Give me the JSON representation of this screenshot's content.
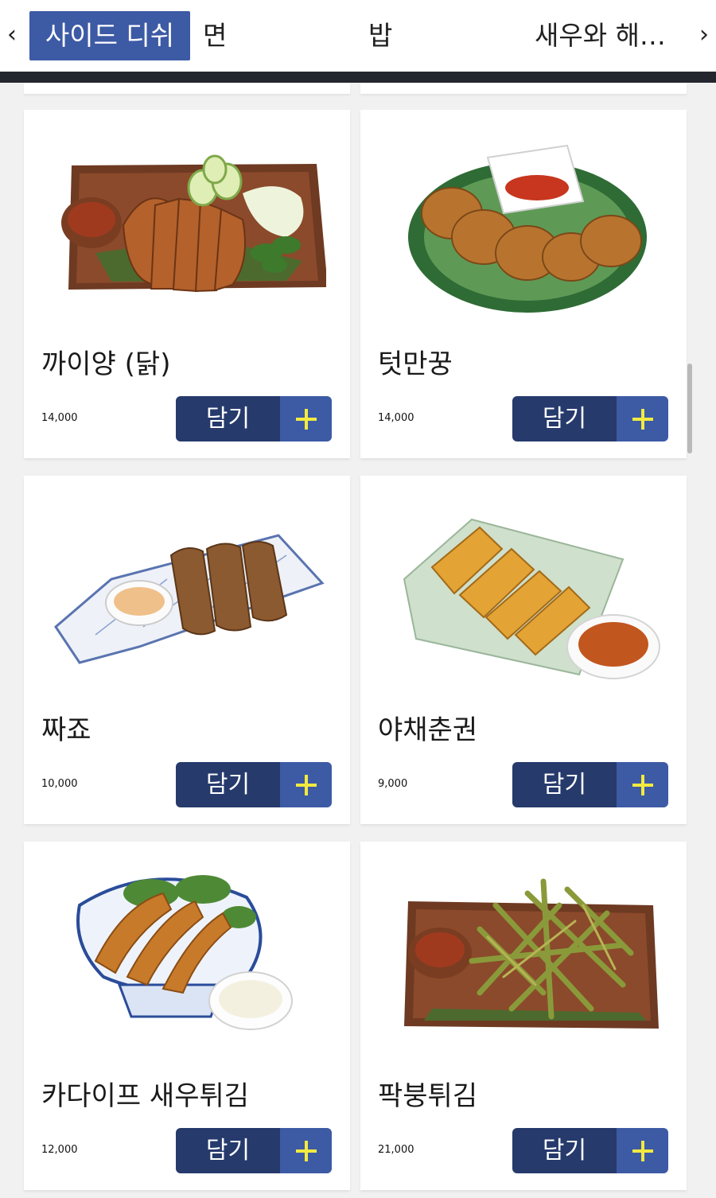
{
  "tabs": [
    {
      "label": "사이드 디쉬",
      "active": true
    },
    {
      "label": "면"
    },
    {
      "label": "밥"
    },
    {
      "label": "새우와 해…"
    }
  ],
  "nav": {
    "prev_icon": "chevron-left-icon",
    "next_icon": "chevron-right-icon"
  },
  "colors": {
    "accent": "#3d5aa5",
    "button_dark": "#263a6c",
    "plus": "#f2ea3f",
    "header_strip": "#23272d"
  },
  "items": [
    {
      "name": "까이양 (닭)",
      "price": "14,000",
      "button_label": "담기",
      "image": "grilled-chicken-platter"
    },
    {
      "name": "텃만꿍",
      "price": "14,000",
      "button_label": "담기",
      "image": "shrimp-cakes"
    },
    {
      "name": "짜죠",
      "price": "10,000",
      "button_label": "담기",
      "image": "fried-rolls-board"
    },
    {
      "name": "야채춘권",
      "price": "9,000",
      "button_label": "담기",
      "image": "spring-rolls"
    },
    {
      "name": "카다이프 새우튀김",
      "price": "12,000",
      "button_label": "담기",
      "image": "kataifi-shrimp"
    },
    {
      "name": "팍붕튀김",
      "price": "21,000",
      "button_label": "담기",
      "image": "fried-morning-glory"
    }
  ]
}
